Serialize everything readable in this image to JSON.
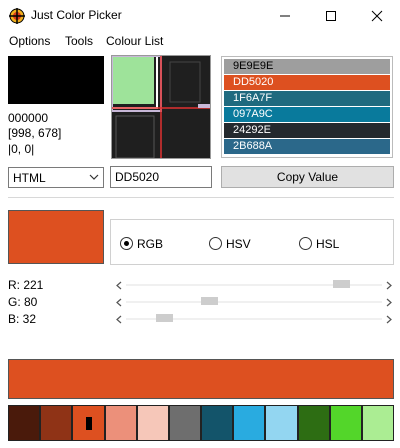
{
  "window": {
    "title": "Just Color Picker",
    "icon": "crosshair-app-icon",
    "controls": [
      "minimize-icon",
      "maximize-icon",
      "close-icon"
    ]
  },
  "menu": [
    "Options",
    "Tools",
    "Colour List"
  ],
  "cursor_info": {
    "color_under_cursor": "000000",
    "position": "[998, 678]",
    "offset": "|0, 0|"
  },
  "colour_list": [
    {
      "code": "9E9E9E",
      "color": "#9E9E9E",
      "text_color": "#000000"
    },
    {
      "code": "DD5020",
      "color": "#DD5020",
      "text_color": "#FFFFFF"
    },
    {
      "code": "1F6A7F",
      "color": "#1F6A7F",
      "text_color": "#FFFFFF"
    },
    {
      "code": "097A9C",
      "color": "#097A9C",
      "text_color": "#FFFFFF"
    },
    {
      "code": "24292E",
      "color": "#24292E",
      "text_color": "#FFFFFF"
    },
    {
      "code": "2B688A",
      "color": "#2B688A",
      "text_color": "#FFFFFF"
    }
  ],
  "format_select": {
    "value": "HTML"
  },
  "hex_input": {
    "value": "DD5020"
  },
  "copy_button": {
    "label": "Copy Value"
  },
  "current_color": "#DD5020",
  "color_modes": [
    {
      "label": "RGB",
      "selected": true
    },
    {
      "label": "HSV",
      "selected": false
    },
    {
      "label": "HSL",
      "selected": false
    }
  ],
  "channels": [
    {
      "label": "R: 221",
      "value": 221,
      "max": 255
    },
    {
      "label": "G: 80",
      "value": 80,
      "max": 255
    },
    {
      "label": "B: 32",
      "value": 32,
      "max": 255
    }
  ],
  "palette": [
    "#4A1A0B",
    "#8F3316",
    "#DD5020",
    "#EC907A",
    "#F6C7B9",
    "#6E6E6E",
    "#13546A",
    "#29ABE0",
    "#93D6F1",
    "#2D6D13",
    "#53D62A",
    "#ABED93"
  ]
}
